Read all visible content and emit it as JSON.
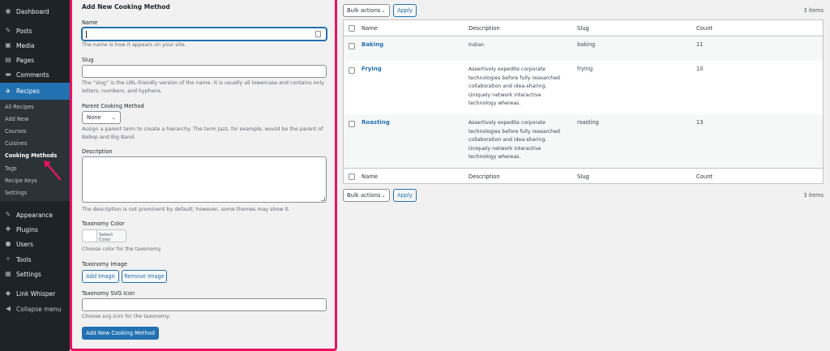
{
  "sidebar": {
    "items": [
      {
        "label": "Dashboard",
        "icon": "dashboard-icon",
        "glyph": "◉"
      },
      {
        "label": "Posts",
        "icon": "pin-icon",
        "glyph": "✎"
      },
      {
        "label": "Media",
        "icon": "media-icon",
        "glyph": "▣"
      },
      {
        "label": "Pages",
        "icon": "pages-icon",
        "glyph": "▤"
      },
      {
        "label": "Comments",
        "icon": "comments-icon",
        "glyph": "▬"
      },
      {
        "label": "Recipes",
        "icon": "recipes-icon",
        "glyph": "✈"
      },
      {
        "label": "Appearance",
        "icon": "brush-icon",
        "glyph": "✎"
      },
      {
        "label": "Plugins",
        "icon": "plugins-icon",
        "glyph": "✚"
      },
      {
        "label": "Users",
        "icon": "users-icon",
        "glyph": "●"
      },
      {
        "label": "Tools",
        "icon": "tools-icon",
        "glyph": "✧"
      },
      {
        "label": "Settings",
        "icon": "settings-icon",
        "glyph": "▦"
      },
      {
        "label": "Link Whisper",
        "icon": "link-whisper-icon",
        "glyph": "◆"
      },
      {
        "label": "Collapse menu",
        "icon": "collapse-icon",
        "glyph": "◀"
      }
    ],
    "submenu": [
      "All Recipes",
      "Add New",
      "Courses",
      "Cuisines",
      "Cooking Methods",
      "Tags",
      "Recipe Keys",
      "Settings"
    ]
  },
  "form": {
    "title": "Add New Cooking Method",
    "name_label": "Name",
    "name_value": "",
    "name_help": "The name is how it appears on your site.",
    "slug_label": "Slug",
    "slug_value": "",
    "slug_help": "The “slug” is the URL-friendly version of the name. It is usually all lowercase and contains only letters, numbers, and hyphens.",
    "parent_label": "Parent Cooking Method",
    "parent_value": "None",
    "parent_help": "Assign a parent term to create a hierarchy. The term Jazz, for example, would be the parent of Bebop and Big Band.",
    "description_label": "Description",
    "description_value": "",
    "description_help": "The description is not prominent by default; however, some themes may show it.",
    "color_label": "Taxonomy Color",
    "color_button": "Select Color",
    "color_help": "Choose color for the taxonomy.",
    "image_label": "Taxonomy Image",
    "add_image": "Add Image",
    "remove_image": "Remove Image",
    "svg_label": "Taxonomy SVG Icon",
    "svg_value": "",
    "svg_help": "Choose svg icon for the taxonomy.",
    "submit": "Add New Cooking Method"
  },
  "table": {
    "bulk_label": "Bulk actions",
    "apply_label": "Apply",
    "count_text": "3 items",
    "columns": [
      "Name",
      "Description",
      "Slug",
      "Count"
    ],
    "rows": [
      {
        "name": "Baking",
        "description": "Indian",
        "slug": "baking",
        "count": "11"
      },
      {
        "name": "Frying",
        "description": "Assertively expedite corporate technologies before fully researched collaboration and idea-sharing. Uniquely network interactive technology whereas.",
        "slug": "frying",
        "count": "10"
      },
      {
        "name": "Roasting",
        "description": "Assertively expedite corporate technologies before fully researched collaboration and idea-sharing. Uniquely network interactive technology whereas.",
        "slug": "roasting",
        "count": "13"
      }
    ]
  },
  "colors": {
    "sidebar_bg": "#1d2327",
    "accent": "#2271b1",
    "highlight": "#e8135f"
  }
}
